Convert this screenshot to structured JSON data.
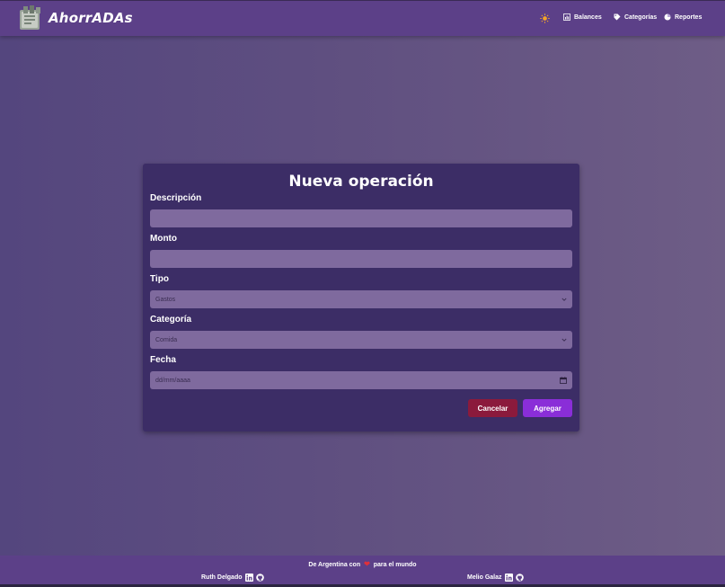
{
  "header": {
    "brand": "AhorrADAs",
    "nav": [
      {
        "label": "Balances",
        "icon": "chart-icon"
      },
      {
        "label": "Categorías",
        "icon": "tag-icon"
      },
      {
        "label": "Reportes",
        "icon": "pie-chart-icon"
      }
    ],
    "theme_icon": "sun-icon"
  },
  "form": {
    "title": "Nueva operación",
    "description_label": "Descripción",
    "description_value": "",
    "amount_label": "Monto",
    "amount_value": "",
    "type_label": "Tipo",
    "type_value": "Gastos",
    "category_label": "Categoría",
    "category_value": "Comida",
    "date_label": "Fecha",
    "date_placeholder": "dd/mm/aaaa",
    "cancel_label": "Cancelar",
    "add_label": "Agregar"
  },
  "footer": {
    "tagline_before": "De Argentina con",
    "tagline_after": "para el mundo",
    "authors": [
      {
        "name": "Ruth Delgado"
      },
      {
        "name": "Melio Galaz"
      }
    ]
  },
  "colors": {
    "header_bg": "#5c4088",
    "card_bg": "#3c2d66",
    "field_bg": "#7f6a9e",
    "cancel_bg": "#8b1a3c",
    "add_bg": "#8a2ed8",
    "heart": "#e0303a"
  }
}
